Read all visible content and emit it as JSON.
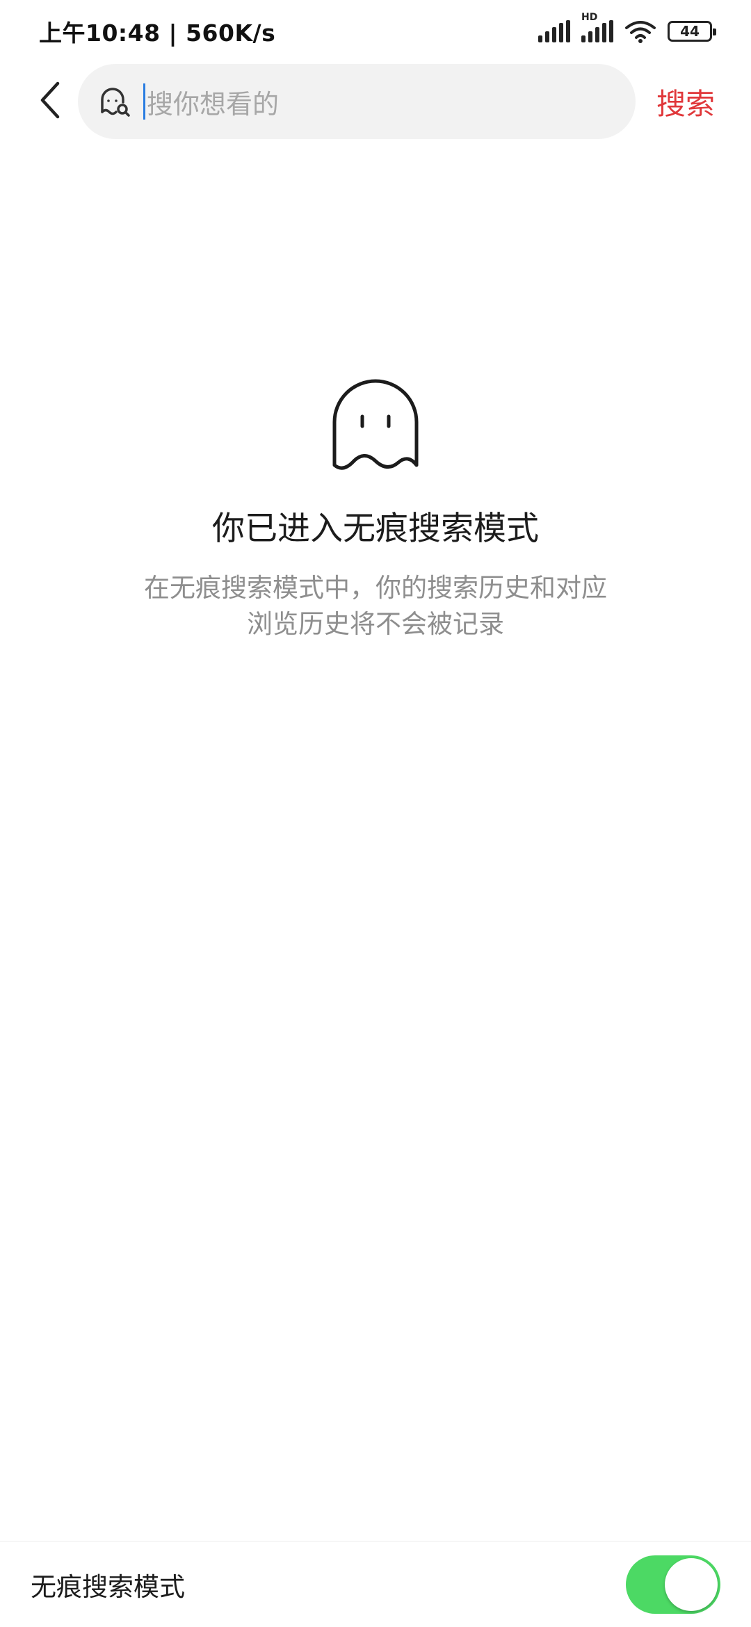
{
  "status_bar": {
    "time_speed": "上午10:48 | 560K/s",
    "hd_label": "HD",
    "battery": "44"
  },
  "header": {
    "back_icon": "chevron-left-icon",
    "search_icon": "ghost-search-icon",
    "search_placeholder": "搜你想看的",
    "search_action_label": "搜索"
  },
  "empty_state": {
    "icon": "ghost-icon",
    "title": "你已进入无痕搜索模式",
    "description_line1": "在无痕搜索模式中，你的搜索历史和对应",
    "description_line2": "浏览历史将不会被记录"
  },
  "bottom_bar": {
    "label": "无痕搜索模式",
    "toggle_on": true
  },
  "colors": {
    "accent_red": "#e0373a",
    "toggle_green": "#4cd964",
    "caret_blue": "#2a7de1"
  }
}
